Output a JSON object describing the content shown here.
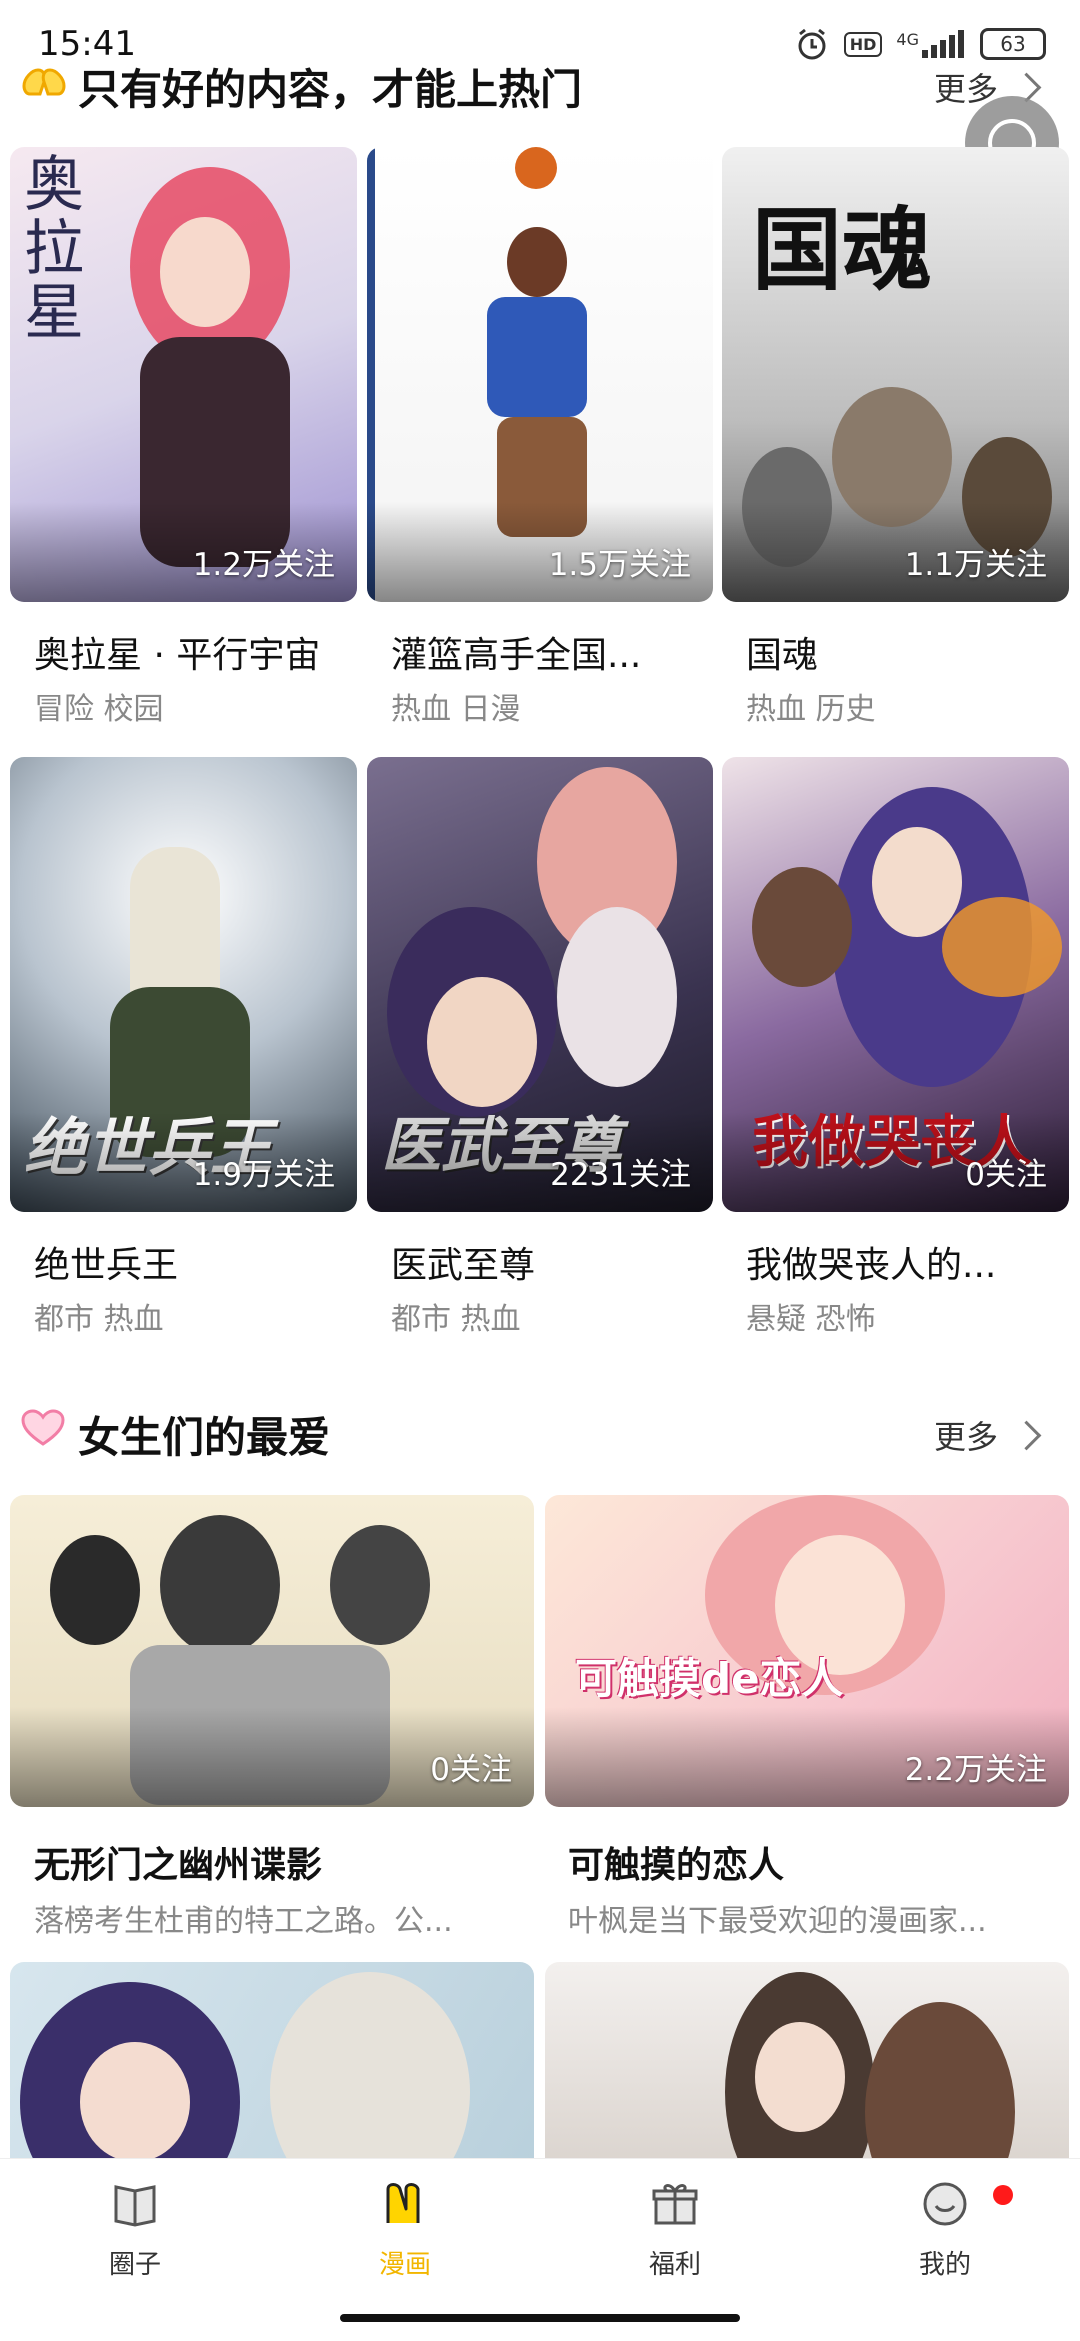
{
  "status_bar": {
    "time": "15:41",
    "network": "4G",
    "hd": "HD",
    "battery": "63"
  },
  "section1": {
    "title": "只有好的内容，才能上热门",
    "more": "更多"
  },
  "section2": {
    "title": "女生们的最爱",
    "more": "更多"
  },
  "grid_cards": [
    {
      "title": "奥拉星 · 平行宇宙",
      "tags": "冒险 校园",
      "follow": "1.2万关注",
      "cover_text": "奥拉星"
    },
    {
      "title": "灌篮高手全国...",
      "tags": "热血 日漫",
      "follow": "1.5万关注",
      "cover_text": ""
    },
    {
      "title": "国魂",
      "tags": "热血 历史",
      "follow": "1.1万关注",
      "cover_text": "国魂"
    },
    {
      "title": "绝世兵王",
      "tags": "都市 热血",
      "follow": "1.9万关注",
      "cover_text": "绝世兵王"
    },
    {
      "title": "医武至尊",
      "tags": "都市 热血",
      "follow": "2231关注",
      "cover_text": "医武至尊"
    },
    {
      "title": "我做哭丧人的...",
      "tags": "悬疑 恐怖",
      "follow": "0关注",
      "cover_text": "我做哭丧人"
    }
  ],
  "wide_cards": [
    {
      "title": "无形门之幽州谍影",
      "desc": "落榜考生杜甫的特工之路。公...",
      "follow": "0关注"
    },
    {
      "title": "可触摸的恋人",
      "desc": "叶枫是当下最受欢迎的漫画家...",
      "follow": "2.2万关注",
      "cover_text": "可触摸de恋人"
    }
  ],
  "bottom_nav": [
    {
      "label": "圈子",
      "icon": "book-icon",
      "active": false
    },
    {
      "label": "漫画",
      "icon": "manga-icon",
      "active": true
    },
    {
      "label": "福利",
      "icon": "gift-icon",
      "active": false
    },
    {
      "label": "我的",
      "icon": "smile-icon",
      "active": false,
      "badge": true
    }
  ],
  "colors": {
    "accent": "#f2b600",
    "badge": "#ff1a1a",
    "tag_text": "#888888"
  }
}
